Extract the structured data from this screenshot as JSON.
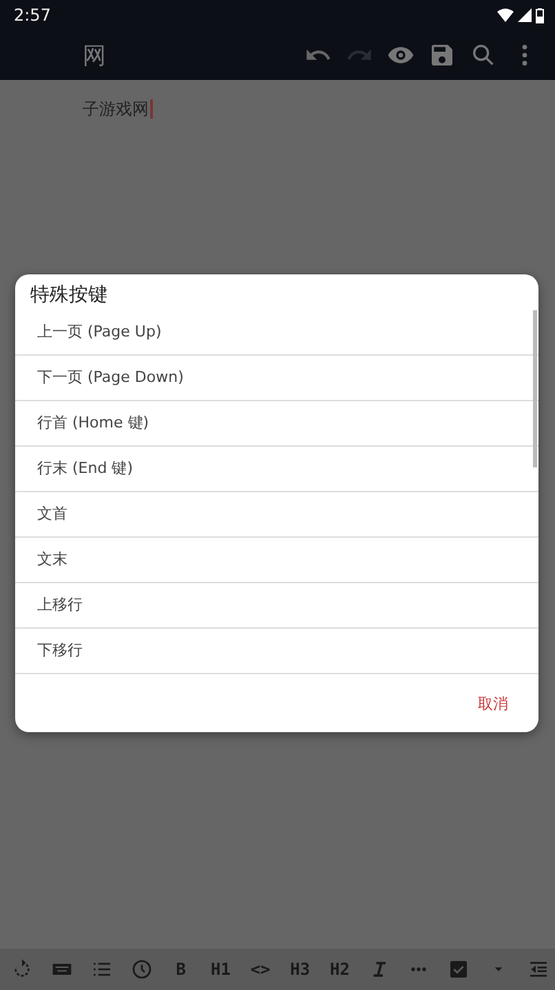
{
  "status_bar": {
    "time": "2:57"
  },
  "app_bar": {
    "title": "网"
  },
  "editor": {
    "text": "子游戏网"
  },
  "dialog": {
    "title": "特殊按键",
    "items": [
      "上一页 (Page Up)",
      "下一页 (Page Down)",
      "行首 (Home 键)",
      "行末 (End 键)",
      "文首",
      "文末",
      "上移行",
      "下移行"
    ],
    "cancel": "取消"
  },
  "bottom_toolbar": {
    "labels": [
      "B",
      "H1",
      "<>",
      "H3",
      "H2"
    ]
  }
}
